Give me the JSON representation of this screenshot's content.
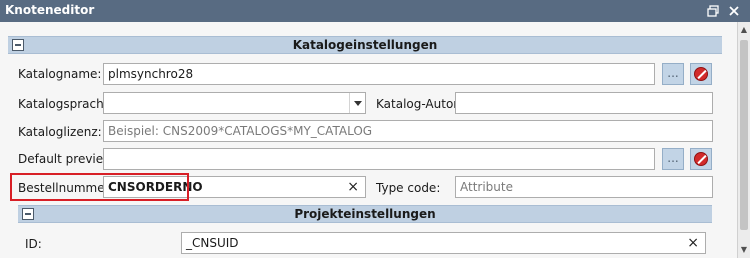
{
  "window": {
    "title": "Knoteneditor",
    "float_icon": "float-window-icon",
    "close_icon": "close-icon"
  },
  "sections": {
    "catalog": {
      "title": "Katalogeinstellungen"
    },
    "project": {
      "title": "Projekteinstellungen"
    }
  },
  "fields": {
    "katalogname": {
      "label": "Katalogname:",
      "value": "plmsynchro28"
    },
    "katalogsprache": {
      "label": "Katalogsprache:",
      "value": ""
    },
    "katalog_autor": {
      "label": "Katalog-Autor:",
      "value": ""
    },
    "kataloglizenz": {
      "label": "Kataloglizenz:",
      "placeholder": "Beispiel: CNS2009*CATALOGS*MY_CATALOG"
    },
    "default_preview": {
      "label": "Default preview:",
      "value": ""
    },
    "bestellnummer": {
      "label": "Bestellnummer:",
      "value": "CNSORDERNO"
    },
    "type_code": {
      "label": "Type code:",
      "placeholder": "Attribute"
    },
    "id": {
      "label": "ID:",
      "value": "_CNSUID"
    }
  },
  "buttons": {
    "browse_label": "...",
    "clear_symbol": "×"
  },
  "colors": {
    "titlebar": "#586b82",
    "section_header": "#bfd0e2",
    "highlight": "#d81f26",
    "stop_button": "#d22b2b"
  }
}
